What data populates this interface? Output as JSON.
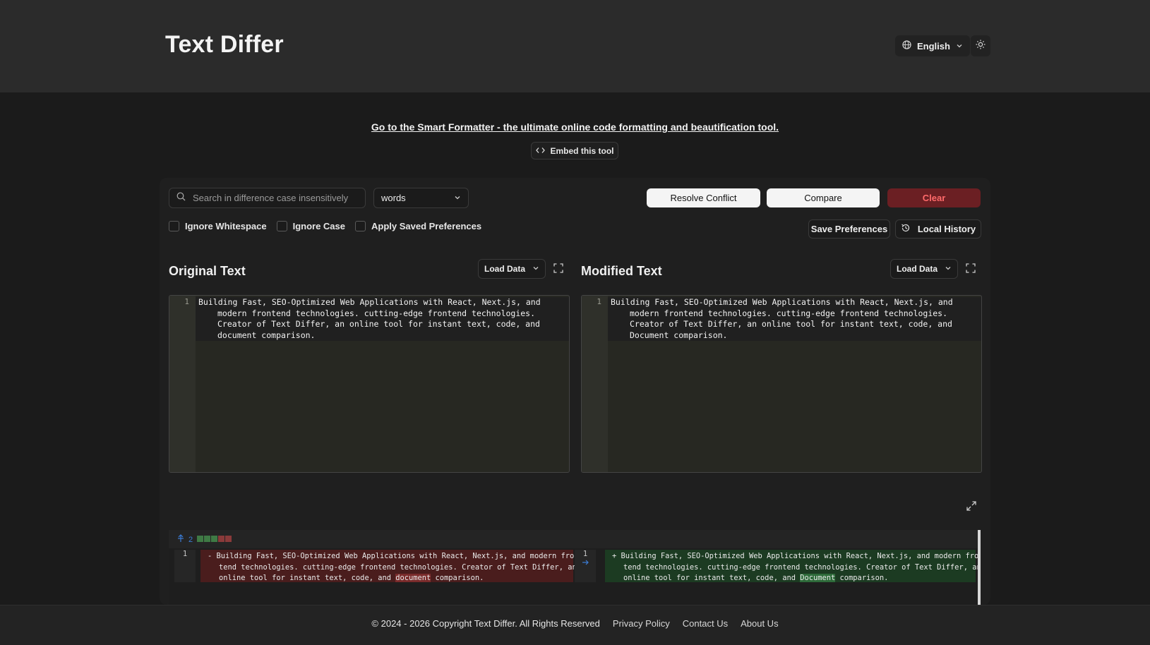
{
  "header": {
    "title": "Text Differ",
    "language": "English"
  },
  "promo": {
    "link": "Go to the Smart Formatter - the ultimate online code formatting and beautification tool."
  },
  "embed": {
    "label": "Embed this tool"
  },
  "toolbar": {
    "search_placeholder": "Search in difference case insensitively",
    "mode": "words",
    "resolve_label": "Resolve Conflict",
    "compare_label": "Compare",
    "clear_label": "Clear",
    "save_prefs_label": "Save Preferences",
    "history_label": "Local History"
  },
  "options": {
    "ignore_whitespace": "Ignore Whitespace",
    "ignore_case": "Ignore Case",
    "apply_saved": "Apply Saved Preferences"
  },
  "original": {
    "title": "Original Text",
    "load_label": "Load Data",
    "line_number": "1",
    "text": "Building Fast, SEO-Optimized Web Applications with React, Next.js, and modern frontend technologies. cutting-edge frontend technologies. Creator of Text Differ, an online tool for instant text, code, and document comparison."
  },
  "modified": {
    "title": "Modified Text",
    "load_label": "Load Data",
    "line_number": "1",
    "text": "Building Fast, SEO-Optimized Web Applications with React, Next.js, and modern frontend technologies. cutting-edge frontend technologies. Creator of Text Differ, an online tool for instant text, code, and Document comparison."
  },
  "diff": {
    "change_count": "2",
    "left_line": "1",
    "right_line": "1",
    "del_prefix": "-",
    "ins_prefix": "+",
    "left_before": "Building Fast, SEO-Optimized Web Applications with React, Next.js, and modern frontend technologies. cutting-edge frontend technologies. Creator of Text Differ, an online tool for instant text, code, and ",
    "left_changed": "document",
    "left_after": " comparison.",
    "right_before": "Building Fast, SEO-Optimized Web Applications with React, Next.js, and modern frontend technologies. cutting-edge frontend technologies. Creator of Text Differ, an online tool for instant text, code, and ",
    "right_changed": "Document",
    "right_after": " comparison."
  },
  "footer": {
    "copyright": "© 2024 - 2026 Copyright Text Differ. All Rights Reserved",
    "privacy": "Privacy Policy",
    "contact": "Contact Us",
    "about": "About Us"
  },
  "colors": {
    "clear_bg": "#6b1f23",
    "clear_text": "#ff6a6a",
    "diff_del": "#4a1d1d",
    "diff_ins": "#1c3b22"
  }
}
